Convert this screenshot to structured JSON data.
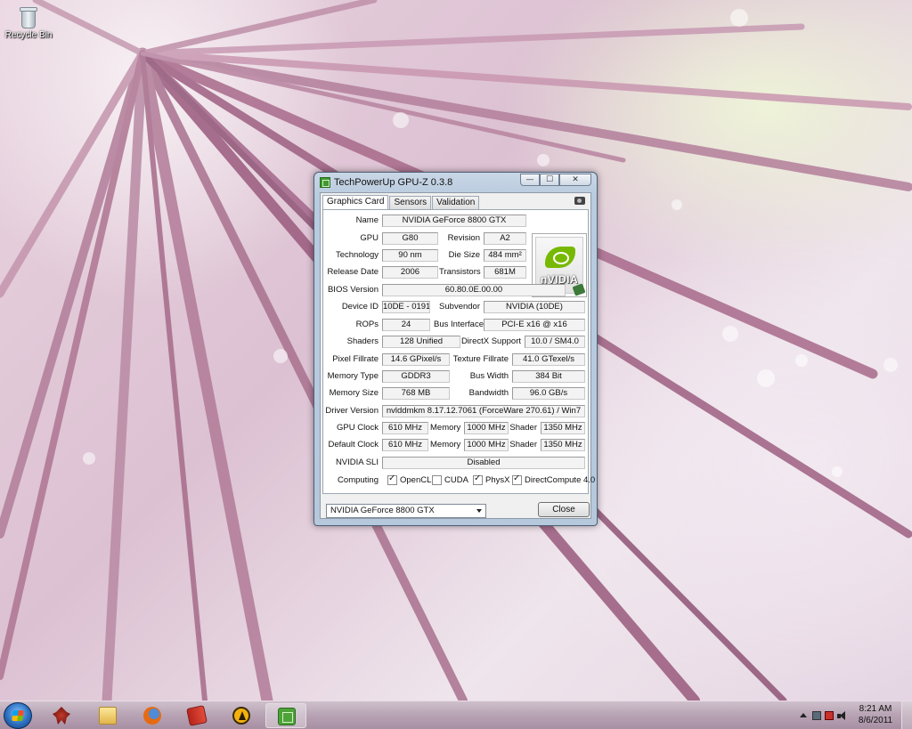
{
  "desktop": {
    "icons": [
      {
        "label": "Recycle Bin",
        "icon": "recycle-bin-icon"
      }
    ]
  },
  "window": {
    "title": "TechPowerUp GPU-Z 0.3.8",
    "buttons": {
      "minimize": "—",
      "maximize": "☐",
      "close": "✕"
    },
    "tabs": [
      "Graphics Card",
      "Sensors",
      "Validation"
    ],
    "active_tab": "Graphics Card",
    "fields": {
      "name_label": "Name",
      "name": "NVIDIA GeForce 8800 GTX",
      "gpu_label": "GPU",
      "gpu": "G80",
      "revision_label": "Revision",
      "revision": "A2",
      "technology_label": "Technology",
      "technology": "90 nm",
      "die_size_label": "Die Size",
      "die_size": "484 mm²",
      "release_date_label": "Release Date",
      "release_date": "2006",
      "transistors_label": "Transistors",
      "transistors": "681M",
      "bios_label": "BIOS Version",
      "bios": "60.80.0E.00.00",
      "device_id_label": "Device ID",
      "device_id": "10DE - 0191",
      "subvendor_label": "Subvendor",
      "subvendor": "NVIDIA (10DE)",
      "rops_label": "ROPs",
      "rops": "24",
      "bus_interface_label": "Bus Interface",
      "bus_interface": "PCI-E x16 @ x16",
      "shaders_label": "Shaders",
      "shaders": "128 Unified",
      "directx_label": "DirectX Support",
      "directx": "10.0 / SM4.0",
      "pixel_fillrate_label": "Pixel Fillrate",
      "pixel_fillrate": "14.6 GPixel/s",
      "texture_fillrate_label": "Texture Fillrate",
      "texture_fillrate": "41.0 GTexel/s",
      "memory_type_label": "Memory Type",
      "memory_type": "GDDR3",
      "bus_width_label": "Bus Width",
      "bus_width": "384 Bit",
      "memory_size_label": "Memory Size",
      "memory_size": "768 MB",
      "bandwidth_label": "Bandwidth",
      "bandwidth": "96.0 GB/s",
      "driver_label": "Driver Version",
      "driver": "nvlddmkm 8.17.12.7061 (ForceWare 270.61) / Win7",
      "gpu_clock_label": "GPU Clock",
      "gpu_clock": "610 MHz",
      "memory_label": "Memory",
      "gpu_clock_memory": "1000 MHz",
      "shader_label": "Shader",
      "gpu_clock_shader": "1350 MHz",
      "default_clock_label": "Default Clock",
      "default_clock": "610 MHz",
      "default_clock_memory": "1000 MHz",
      "default_clock_shader": "1350 MHz",
      "sli_label": "NVIDIA SLI",
      "sli": "Disabled",
      "computing_label": "Computing"
    },
    "computing": [
      {
        "label": "OpenCL",
        "checked": true
      },
      {
        "label": "CUDA",
        "checked": false
      },
      {
        "label": "PhysX",
        "checked": true
      },
      {
        "label": "DirectCompute 4.0",
        "checked": true
      }
    ],
    "logo_text": "nVIDIA",
    "card_select": "NVIDIA GeForce 8800 GTX",
    "close_button": "Close"
  },
  "taskbar": {
    "items": [
      {
        "name": "start-button",
        "icon": "windows-logo-icon"
      },
      {
        "name": "taskbar-app-1",
        "icon": "red-creature-icon"
      },
      {
        "name": "taskbar-explorer",
        "icon": "folder-icon"
      },
      {
        "name": "taskbar-firefox",
        "icon": "firefox-icon"
      },
      {
        "name": "taskbar-book",
        "icon": "red-book-icon"
      },
      {
        "name": "taskbar-aim",
        "icon": "aim-icon"
      },
      {
        "name": "taskbar-gpuz",
        "icon": "gpuz-icon",
        "active": true
      }
    ],
    "clock_time": "8:21 AM",
    "clock_date": "8/6/2011"
  }
}
